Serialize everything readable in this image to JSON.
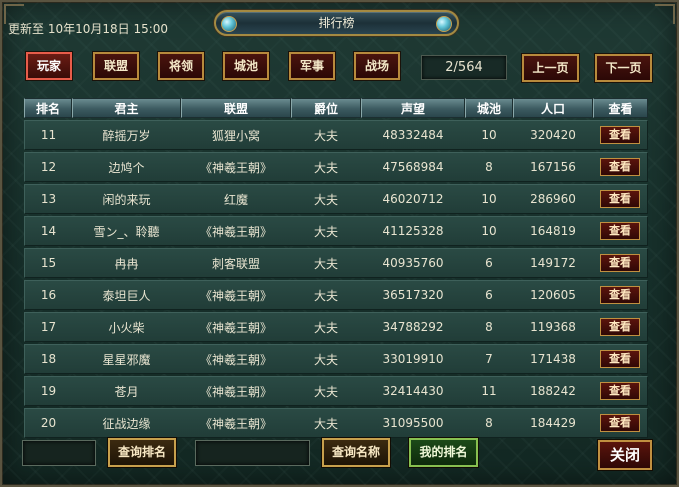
{
  "header": {
    "update_text": "更新至 10年10月18日 15:00",
    "title": "排行榜"
  },
  "tabs": [
    {
      "label": "玩家",
      "active": true
    },
    {
      "label": "联盟",
      "active": false
    },
    {
      "label": "将领",
      "active": false
    },
    {
      "label": "城池",
      "active": false
    },
    {
      "label": "军事",
      "active": false
    },
    {
      "label": "战场",
      "active": false
    }
  ],
  "pagination": {
    "page_indicator": "2/564",
    "prev_label": "上一页",
    "next_label": "下一页"
  },
  "table": {
    "columns": [
      "排名",
      "君主",
      "联盟",
      "爵位",
      "声望",
      "城池",
      "人口",
      "查看"
    ],
    "view_label": "查看",
    "rows": [
      {
        "rank": "11",
        "lord": "醉摇万岁",
        "alliance": "狐狸小窝",
        "title": "大夫",
        "prestige": "48332484",
        "cities": "10",
        "population": "320420"
      },
      {
        "rank": "12",
        "lord": "边鸠个",
        "alliance": "《神羲王朝》",
        "title": "大夫",
        "prestige": "47568984",
        "cities": "8",
        "population": "167156"
      },
      {
        "rank": "13",
        "lord": "闲的来玩",
        "alliance": "红魔",
        "title": "大夫",
        "prestige": "46020712",
        "cities": "10",
        "population": "286960"
      },
      {
        "rank": "14",
        "lord": "雪ン_、聆聽",
        "alliance": "《神羲王朝》",
        "title": "大夫",
        "prestige": "41125328",
        "cities": "10",
        "population": "164819"
      },
      {
        "rank": "15",
        "lord": "冉冉",
        "alliance": "刺客联盟",
        "title": "大夫",
        "prestige": "40935760",
        "cities": "6",
        "population": "149172"
      },
      {
        "rank": "16",
        "lord": "泰坦巨人",
        "alliance": "《神羲王朝》",
        "title": "大夫",
        "prestige": "36517320",
        "cities": "6",
        "population": "120605"
      },
      {
        "rank": "17",
        "lord": "小火柴",
        "alliance": "《神羲王朝》",
        "title": "大夫",
        "prestige": "34788292",
        "cities": "8",
        "population": "119368"
      },
      {
        "rank": "18",
        "lord": "星星邪魔",
        "alliance": "《神羲王朝》",
        "title": "大夫",
        "prestige": "33019910",
        "cities": "7",
        "population": "171438"
      },
      {
        "rank": "19",
        "lord": "苍月",
        "alliance": "《神羲王朝》",
        "title": "大夫",
        "prestige": "32414430",
        "cities": "11",
        "population": "188242"
      },
      {
        "rank": "20",
        "lord": "征战边缘",
        "alliance": "《神羲王朝》",
        "title": "大夫",
        "prestige": "31095500",
        "cities": "8",
        "population": "184429"
      }
    ]
  },
  "footer": {
    "query_rank_label": "查询排名",
    "query_name_label": "查询名称",
    "my_rank_label": "我的排名",
    "close_label": "关闭"
  }
}
